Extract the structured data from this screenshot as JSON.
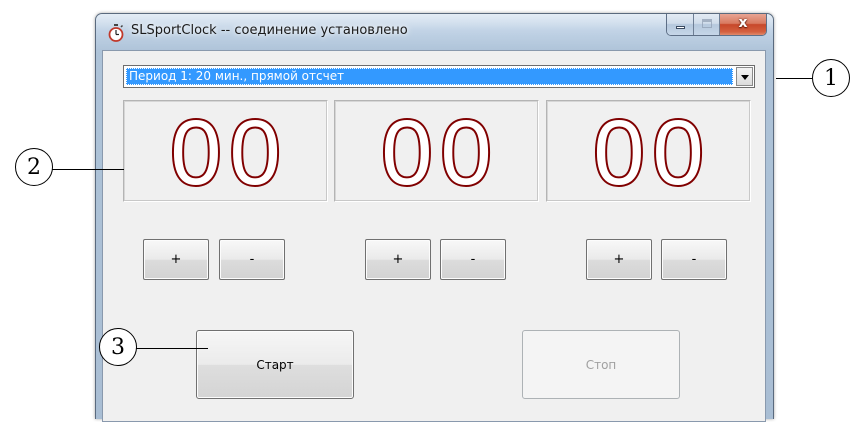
{
  "window": {
    "title": "SLSportClock -- соединение установлено",
    "close_glyph": "x"
  },
  "period_select": {
    "selected": "Период 1: 20 мин., прямой отсчет"
  },
  "timer": {
    "panels": [
      {
        "value": "00"
      },
      {
        "value": "00"
      },
      {
        "value": "00"
      }
    ],
    "digit_color": "#800000"
  },
  "adjust_buttons": {
    "plus_label": "+",
    "minus_label": "-"
  },
  "controls": {
    "start_label": "Старт",
    "stop_label": "Стоп",
    "stop_enabled": false
  },
  "callouts": {
    "c1": "1",
    "c2": "2",
    "c3": "3"
  },
  "colors": {
    "selection_blue": "#3399ff",
    "close_red": "#c7482a"
  }
}
